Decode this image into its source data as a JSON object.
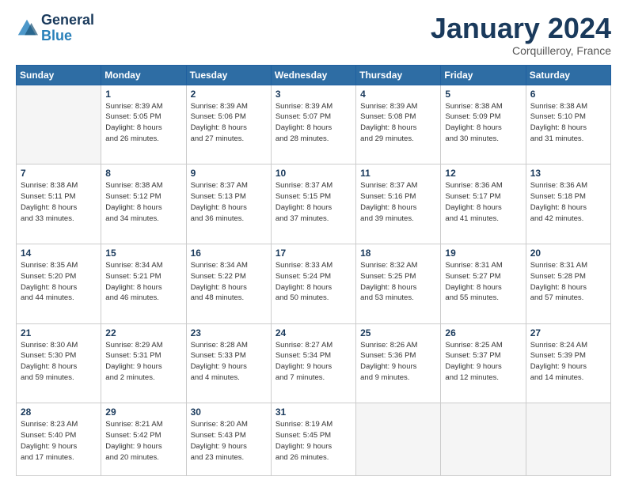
{
  "logo": {
    "line1": "General",
    "line2": "Blue"
  },
  "header": {
    "month": "January 2024",
    "location": "Corquilleroy, France"
  },
  "weekdays": [
    "Sunday",
    "Monday",
    "Tuesday",
    "Wednesday",
    "Thursday",
    "Friday",
    "Saturday"
  ],
  "weeks": [
    [
      {
        "day": "",
        "info": ""
      },
      {
        "day": "1",
        "info": "Sunrise: 8:39 AM\nSunset: 5:05 PM\nDaylight: 8 hours\nand 26 minutes."
      },
      {
        "day": "2",
        "info": "Sunrise: 8:39 AM\nSunset: 5:06 PM\nDaylight: 8 hours\nand 27 minutes."
      },
      {
        "day": "3",
        "info": "Sunrise: 8:39 AM\nSunset: 5:07 PM\nDaylight: 8 hours\nand 28 minutes."
      },
      {
        "day": "4",
        "info": "Sunrise: 8:39 AM\nSunset: 5:08 PM\nDaylight: 8 hours\nand 29 minutes."
      },
      {
        "day": "5",
        "info": "Sunrise: 8:38 AM\nSunset: 5:09 PM\nDaylight: 8 hours\nand 30 minutes."
      },
      {
        "day": "6",
        "info": "Sunrise: 8:38 AM\nSunset: 5:10 PM\nDaylight: 8 hours\nand 31 minutes."
      }
    ],
    [
      {
        "day": "7",
        "info": "Sunrise: 8:38 AM\nSunset: 5:11 PM\nDaylight: 8 hours\nand 33 minutes."
      },
      {
        "day": "8",
        "info": "Sunrise: 8:38 AM\nSunset: 5:12 PM\nDaylight: 8 hours\nand 34 minutes."
      },
      {
        "day": "9",
        "info": "Sunrise: 8:37 AM\nSunset: 5:13 PM\nDaylight: 8 hours\nand 36 minutes."
      },
      {
        "day": "10",
        "info": "Sunrise: 8:37 AM\nSunset: 5:15 PM\nDaylight: 8 hours\nand 37 minutes."
      },
      {
        "day": "11",
        "info": "Sunrise: 8:37 AM\nSunset: 5:16 PM\nDaylight: 8 hours\nand 39 minutes."
      },
      {
        "day": "12",
        "info": "Sunrise: 8:36 AM\nSunset: 5:17 PM\nDaylight: 8 hours\nand 41 minutes."
      },
      {
        "day": "13",
        "info": "Sunrise: 8:36 AM\nSunset: 5:18 PM\nDaylight: 8 hours\nand 42 minutes."
      }
    ],
    [
      {
        "day": "14",
        "info": "Sunrise: 8:35 AM\nSunset: 5:20 PM\nDaylight: 8 hours\nand 44 minutes."
      },
      {
        "day": "15",
        "info": "Sunrise: 8:34 AM\nSunset: 5:21 PM\nDaylight: 8 hours\nand 46 minutes."
      },
      {
        "day": "16",
        "info": "Sunrise: 8:34 AM\nSunset: 5:22 PM\nDaylight: 8 hours\nand 48 minutes."
      },
      {
        "day": "17",
        "info": "Sunrise: 8:33 AM\nSunset: 5:24 PM\nDaylight: 8 hours\nand 50 minutes."
      },
      {
        "day": "18",
        "info": "Sunrise: 8:32 AM\nSunset: 5:25 PM\nDaylight: 8 hours\nand 53 minutes."
      },
      {
        "day": "19",
        "info": "Sunrise: 8:31 AM\nSunset: 5:27 PM\nDaylight: 8 hours\nand 55 minutes."
      },
      {
        "day": "20",
        "info": "Sunrise: 8:31 AM\nSunset: 5:28 PM\nDaylight: 8 hours\nand 57 minutes."
      }
    ],
    [
      {
        "day": "21",
        "info": "Sunrise: 8:30 AM\nSunset: 5:30 PM\nDaylight: 8 hours\nand 59 minutes."
      },
      {
        "day": "22",
        "info": "Sunrise: 8:29 AM\nSunset: 5:31 PM\nDaylight: 9 hours\nand 2 minutes."
      },
      {
        "day": "23",
        "info": "Sunrise: 8:28 AM\nSunset: 5:33 PM\nDaylight: 9 hours\nand 4 minutes."
      },
      {
        "day": "24",
        "info": "Sunrise: 8:27 AM\nSunset: 5:34 PM\nDaylight: 9 hours\nand 7 minutes."
      },
      {
        "day": "25",
        "info": "Sunrise: 8:26 AM\nSunset: 5:36 PM\nDaylight: 9 hours\nand 9 minutes."
      },
      {
        "day": "26",
        "info": "Sunrise: 8:25 AM\nSunset: 5:37 PM\nDaylight: 9 hours\nand 12 minutes."
      },
      {
        "day": "27",
        "info": "Sunrise: 8:24 AM\nSunset: 5:39 PM\nDaylight: 9 hours\nand 14 minutes."
      }
    ],
    [
      {
        "day": "28",
        "info": "Sunrise: 8:23 AM\nSunset: 5:40 PM\nDaylight: 9 hours\nand 17 minutes."
      },
      {
        "day": "29",
        "info": "Sunrise: 8:21 AM\nSunset: 5:42 PM\nDaylight: 9 hours\nand 20 minutes."
      },
      {
        "day": "30",
        "info": "Sunrise: 8:20 AM\nSunset: 5:43 PM\nDaylight: 9 hours\nand 23 minutes."
      },
      {
        "day": "31",
        "info": "Sunrise: 8:19 AM\nSunset: 5:45 PM\nDaylight: 9 hours\nand 26 minutes."
      },
      {
        "day": "",
        "info": ""
      },
      {
        "day": "",
        "info": ""
      },
      {
        "day": "",
        "info": ""
      }
    ]
  ]
}
